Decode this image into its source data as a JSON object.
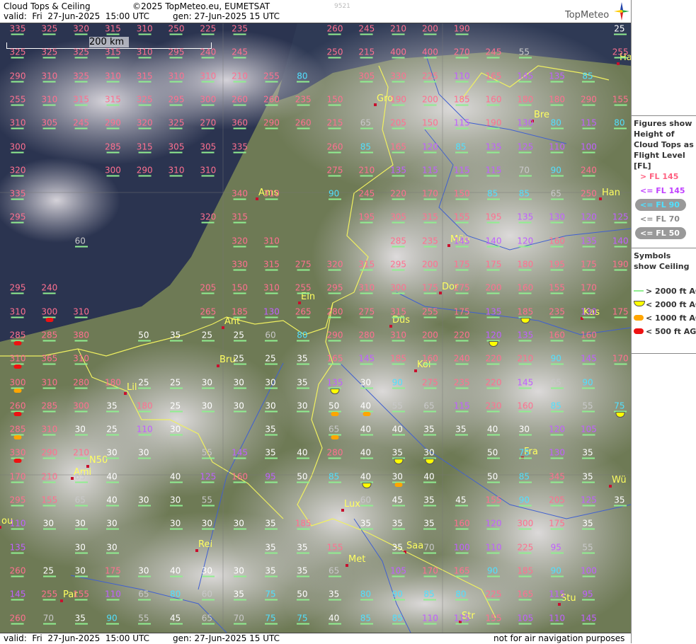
{
  "header": {
    "title": "Cloud Tops & Ceiling",
    "copyright": "©2025 TopMeteo.eu, EUMETSAT",
    "valid": "valid:  Fri  27-Jun-2025  15:00 UTC",
    "gen": "gen: 27-Jun-2025 15 UTC",
    "id": "9521",
    "logo": "TopMeteo"
  },
  "footer": {
    "valid": "valid:  Fri  27-Jun-2025  15:00 UTC",
    "gen": "gen: 27-Jun-2025 15 UTC",
    "disclaimer": "not for air navigation purposes"
  },
  "scale": {
    "label": "200 km"
  },
  "legend": {
    "tops_title": "Figures show Height of Cloud Tops as Flight Level [FL]",
    "tops": [
      {
        "label": "> FL 145",
        "color": "#ff6080",
        "bg": ""
      },
      {
        "label": "<= FL 145",
        "color": "#c040ff",
        "bg": ""
      },
      {
        "label": "<= FL 90",
        "color": "#50e0ff",
        "bg": "#999999"
      },
      {
        "label": "<= FL 70",
        "color": "#888888",
        "bg": ""
      },
      {
        "label": "<= FL 50",
        "color": "#ffffff",
        "bg": "#999999"
      }
    ],
    "ceiling_title": "Symbols show Ceiling",
    "ceiling": [
      {
        "label": "> 2000 ft AGL",
        "color": "#90ee90",
        "shape": "line"
      },
      {
        "label": "< 2000 ft AGL",
        "color": "#ffff00",
        "shape": "half"
      },
      {
        "label": "< 1000 ft AGL",
        "color": "#ffa500",
        "shape": "pill"
      },
      {
        "label": "< 500 ft AGL",
        "color": "#ee1111",
        "shape": "pill"
      }
    ]
  },
  "cities": [
    {
      "name": "Gro"
    },
    {
      "name": "Bre"
    },
    {
      "name": "Ha"
    },
    {
      "name": "Ams"
    },
    {
      "name": "Han"
    },
    {
      "name": "Mün"
    },
    {
      "name": "Dor"
    },
    {
      "name": "Ein"
    },
    {
      "name": "Ant"
    },
    {
      "name": "Düs"
    },
    {
      "name": "Kas"
    },
    {
      "name": "Bru"
    },
    {
      "name": "Köl"
    },
    {
      "name": "Lil"
    },
    {
      "name": "Fra"
    },
    {
      "name": "N50"
    },
    {
      "name": "Ami"
    },
    {
      "name": "Wü"
    },
    {
      "name": "Lux"
    },
    {
      "name": "ou"
    },
    {
      "name": "Rei"
    },
    {
      "name": "Saa"
    },
    {
      "name": "Met"
    },
    {
      "name": "Par"
    },
    {
      "name": "Stu"
    },
    {
      "name": "Str"
    }
  ],
  "grid": [
    [
      335,
      325,
      320,
      315,
      310,
      250,
      225,
      235,
      null,
      null,
      260,
      245,
      210,
      200,
      190,
      null,
      null,
      null,
      null,
      25
    ],
    [
      325,
      325,
      325,
      315,
      310,
      295,
      240,
      245,
      null,
      null,
      250,
      215,
      400,
      400,
      270,
      245,
      55,
      null,
      null,
      255
    ],
    [
      290,
      310,
      325,
      310,
      315,
      310,
      310,
      210,
      255,
      80,
      null,
      305,
      330,
      225,
      110,
      165,
      145,
      135,
      85,
      null
    ],
    [
      255,
      310,
      315,
      315,
      325,
      295,
      300,
      260,
      260,
      235,
      150,
      null,
      190,
      200,
      185,
      160,
      180,
      180,
      290,
      155
    ],
    [
      310,
      305,
      245,
      290,
      320,
      325,
      270,
      360,
      290,
      260,
      215,
      65,
      205,
      150,
      115,
      190,
      130,
      80,
      115,
      80
    ],
    [
      300,
      null,
      null,
      285,
      315,
      305,
      305,
      335,
      null,
      null,
      260,
      85,
      165,
      120,
      85,
      135,
      125,
      110,
      100,
      null
    ],
    [
      320,
      null,
      null,
      300,
      290,
      310,
      310,
      null,
      null,
      null,
      275,
      210,
      135,
      115,
      115,
      115,
      70,
      90,
      240,
      null
    ],
    [
      335,
      null,
      null,
      null,
      null,
      null,
      null,
      340,
      310,
      null,
      90,
      245,
      220,
      170,
      150,
      85,
      85,
      65,
      250,
      null
    ],
    [
      295,
      null,
      null,
      null,
      null,
      null,
      320,
      315,
      null,
      null,
      null,
      195,
      305,
      315,
      155,
      195,
      135,
      130,
      120,
      125
    ],
    [
      null,
      null,
      60,
      null,
      null,
      null,
      null,
      320,
      310,
      null,
      null,
      null,
      285,
      235,
      145,
      140,
      120,
      160,
      135,
      140
    ],
    [
      null,
      null,
      null,
      null,
      null,
      null,
      null,
      330,
      315,
      275,
      320,
      315,
      295,
      200,
      175,
      175,
      180,
      195,
      175,
      190
    ],
    [
      295,
      240,
      null,
      null,
      null,
      null,
      205,
      150,
      310,
      255,
      295,
      310,
      300,
      175,
      275,
      200,
      160,
      155,
      170,
      null
    ],
    [
      310,
      300,
      310,
      null,
      null,
      null,
      265,
      185,
      130,
      265,
      280,
      275,
      315,
      255,
      175,
      135,
      185,
      235,
      130,
      175
    ],
    [
      285,
      285,
      380,
      null,
      50,
      35,
      25,
      25,
      60,
      80,
      290,
      280,
      310,
      200,
      220,
      120,
      135,
      160,
      160,
      null
    ],
    [
      310,
      365,
      310,
      null,
      null,
      null,
      null,
      25,
      25,
      35,
      165,
      145,
      185,
      160,
      240,
      220,
      210,
      90,
      145,
      170
    ],
    [
      300,
      310,
      280,
      180,
      25,
      25,
      30,
      30,
      30,
      35,
      135,
      30,
      90,
      275,
      235,
      220,
      145,
      65,
      90,
      null
    ],
    [
      260,
      285,
      300,
      35,
      180,
      25,
      30,
      30,
      30,
      30,
      50,
      40,
      55,
      65,
      115,
      230,
      160,
      85,
      55,
      75
    ],
    [
      285,
      310,
      30,
      25,
      110,
      30,
      null,
      null,
      35,
      null,
      65,
      40,
      40,
      35,
      35,
      40,
      30,
      120,
      105,
      null
    ],
    [
      330,
      290,
      210,
      30,
      30,
      null,
      55,
      145,
      35,
      40,
      280,
      40,
      35,
      30,
      null,
      50,
      75,
      130,
      35,
      null
    ],
    [
      170,
      210,
      65,
      40,
      null,
      40,
      125,
      160,
      95,
      50,
      85,
      40,
      30,
      40,
      null,
      50,
      85,
      345,
      35,
      null
    ],
    [
      295,
      155,
      65,
      40,
      30,
      30,
      55,
      null,
      null,
      null,
      null,
      60,
      45,
      35,
      45,
      155,
      90,
      205,
      125,
      35
    ],
    [
      110,
      30,
      30,
      30,
      null,
      30,
      30,
      30,
      35,
      185,
      null,
      35,
      35,
      35,
      160,
      120,
      300,
      175,
      35,
      null
    ],
    [
      135,
      null,
      30,
      30,
      null,
      null,
      null,
      null,
      35,
      35,
      155,
      null,
      35,
      70,
      100,
      110,
      225,
      95,
      55,
      null
    ],
    [
      260,
      25,
      30,
      175,
      30,
      40,
      30,
      30,
      35,
      35,
      65,
      null,
      105,
      170,
      165,
      90,
      185,
      90,
      100,
      null
    ],
    [
      145,
      255,
      155,
      110,
      65,
      80,
      60,
      35,
      75,
      50,
      35,
      80,
      90,
      85,
      80,
      225,
      165,
      115,
      95,
      null
    ],
    [
      260,
      70,
      35,
      90,
      55,
      45,
      65,
      70,
      75,
      75,
      40,
      85,
      85,
      110,
      115,
      155,
      105,
      110,
      145,
      null
    ]
  ],
  "ceiling_symbols": [
    {
      "row": 12,
      "col": 1,
      "k": "r"
    },
    {
      "row": 13,
      "col": 0,
      "k": "r"
    },
    {
      "row": 14,
      "col": 0,
      "k": "r"
    },
    {
      "row": 15,
      "col": 0,
      "k": "o"
    },
    {
      "row": 16,
      "col": 0,
      "k": "r"
    },
    {
      "row": 17,
      "col": 0,
      "k": "o"
    },
    {
      "row": 18,
      "col": 0,
      "k": "r"
    },
    {
      "row": 16,
      "col": 10,
      "k": "o"
    },
    {
      "row": 16,
      "col": 11,
      "k": "o"
    },
    {
      "row": 17,
      "col": 10,
      "k": "o"
    },
    {
      "row": 15,
      "col": 10,
      "k": "y"
    },
    {
      "row": 18,
      "col": 12,
      "k": "y"
    },
    {
      "row": 18,
      "col": 13,
      "k": "y"
    },
    {
      "row": 19,
      "col": 11,
      "k": "y"
    },
    {
      "row": 19,
      "col": 12,
      "k": "o"
    },
    {
      "row": 12,
      "col": 16,
      "k": "y"
    },
    {
      "row": 13,
      "col": 15,
      "k": "y"
    },
    {
      "row": 16,
      "col": 19,
      "k": "y"
    }
  ]
}
